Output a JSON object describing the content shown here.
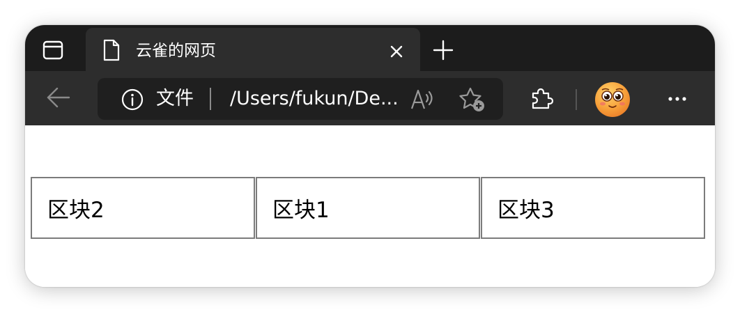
{
  "browser": {
    "tab": {
      "title": "云雀的网页"
    },
    "address": {
      "site_label": "文件",
      "url": "/Users/fukun/De..."
    }
  },
  "icons": {
    "sidebar": "sidebar-toggle-icon",
    "page": "page-icon",
    "close": "close-icon",
    "new_tab": "plus-icon",
    "back": "back-arrow-icon",
    "info": "info-icon",
    "read_aloud": "read-aloud-icon",
    "favorites": "add-favorite-icon",
    "extensions": "puzzle-icon",
    "profile": "avatar-icon",
    "more": "more-icon"
  },
  "page": {
    "blocks": [
      "区块2",
      "区块1",
      "区块3"
    ]
  },
  "colors": {
    "tabstrip": "#1c1c1c",
    "toolbar": "#2d2d2d",
    "addressbar": "#1f1f1f",
    "block_border": "#7b7b7b"
  }
}
